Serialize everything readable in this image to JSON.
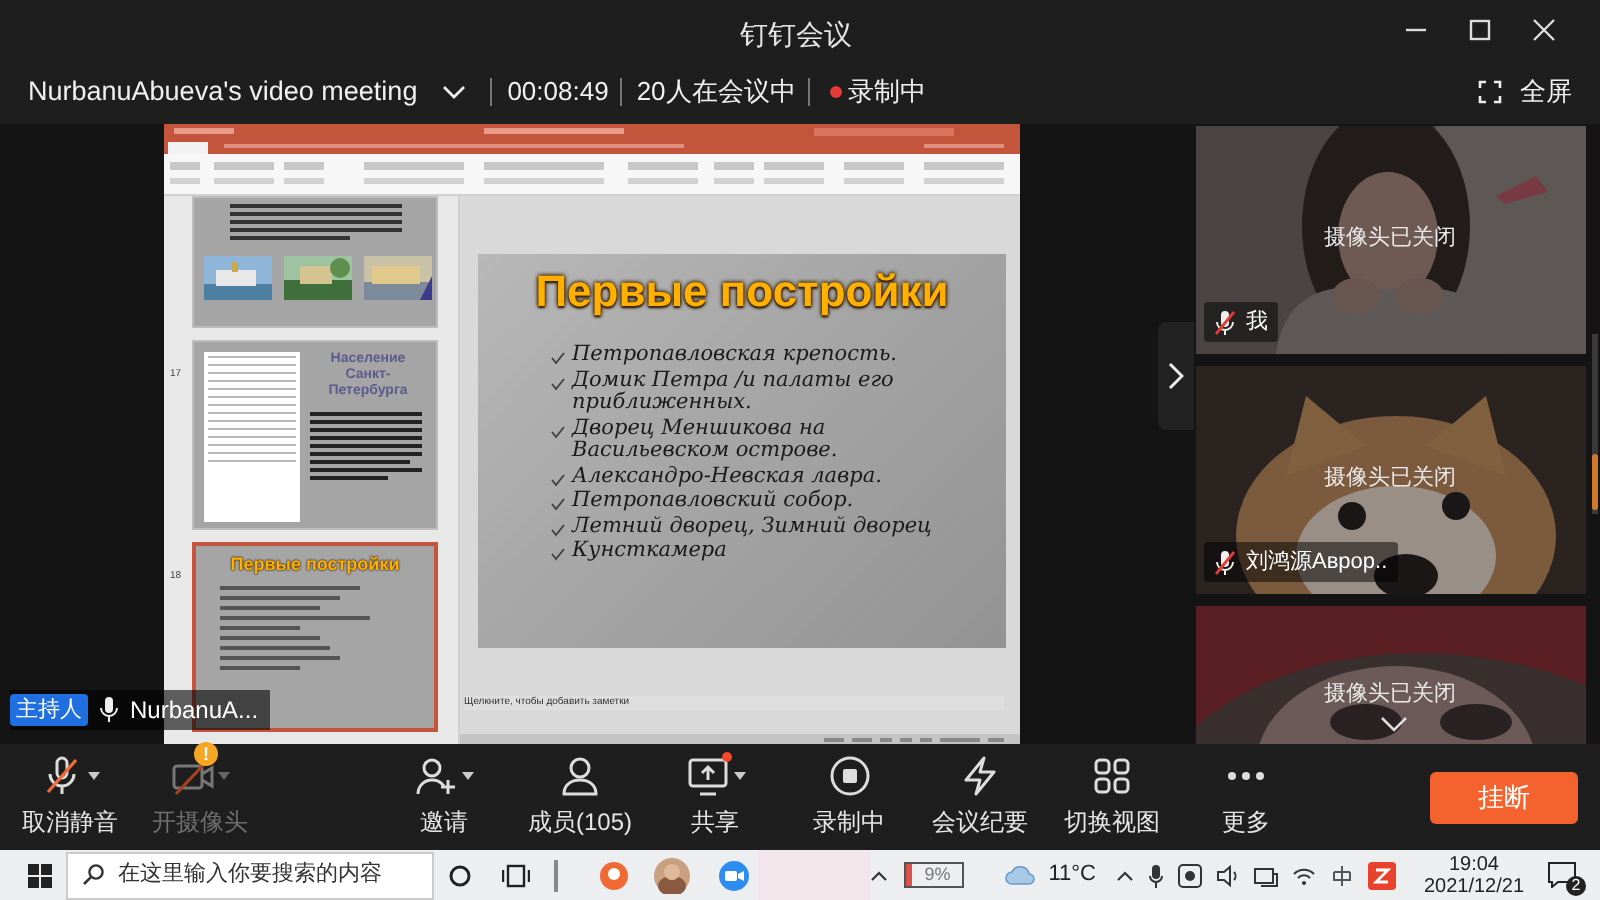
{
  "window": {
    "title": "钉钉会议"
  },
  "meeting": {
    "name": "NurbanuAbueva's video meeting",
    "duration": "00:08:49",
    "participants": "20人在会议中",
    "recording": "录制中",
    "fullscreen": "全屏"
  },
  "shared_screen": {
    "thumbnails": [
      {
        "kind": "photos",
        "selected": false
      },
      {
        "kind": "chart",
        "number": "17",
        "title": "Население Санкт-Петербурга",
        "selected": false
      },
      {
        "kind": "title",
        "number": "18",
        "title": "Первые постройки",
        "selected": true
      }
    ],
    "slide": {
      "title": "Первые постройки",
      "bullets": [
        "Петропавловская крепость.",
        "Домик Петра /и палаты его приближенных.",
        "Дворец Меншикова на Васильевском острове.",
        "Александро-Невская лавра.",
        "Петропавловский собор.",
        "Летний дворец, Зимний дворец",
        "Кунсткамера"
      ]
    },
    "notes_placeholder": "Щелкните, чтобы добавить заметки"
  },
  "host": {
    "role": "主持人",
    "name": "NurbanuA..."
  },
  "video_tiles": [
    {
      "kind": "person",
      "status": "摄像头已关闭",
      "name": "我",
      "muted": true
    },
    {
      "kind": "dog",
      "status": "摄像头已关闭",
      "name": "刘鸿源Аврор..",
      "muted": true
    },
    {
      "kind": "drawing",
      "status": "摄像头已关闭"
    }
  ],
  "toolbar": [
    {
      "kind": "mic",
      "label": "取消静音",
      "has_menu": true,
      "disabled": false
    },
    {
      "kind": "camera",
      "label": "开摄像头",
      "has_menu": true,
      "disabled": true,
      "badge": "!"
    },
    {
      "kind": "invite",
      "label": "邀请",
      "has_menu": true,
      "disabled": false
    },
    {
      "kind": "members",
      "label": "成员(105)",
      "has_menu": false,
      "disabled": false
    },
    {
      "kind": "share",
      "label": "共享",
      "has_menu": true,
      "disabled": false,
      "notified": true
    },
    {
      "kind": "record",
      "label": "录制中",
      "has_menu": false,
      "disabled": false
    },
    {
      "kind": "minutes",
      "label": "会议纪要",
      "has_menu": false,
      "disabled": false
    },
    {
      "kind": "view",
      "label": "切换视图",
      "has_menu": false,
      "disabled": false
    },
    {
      "kind": "more",
      "label": "更多",
      "has_menu": false,
      "disabled": false
    }
  ],
  "hangup": "挂断",
  "taskbar": {
    "search_placeholder": "在这里输入你要搜索的内容",
    "battery": "9%",
    "temperature": "11°C",
    "time": "19:04",
    "date": "2021/12/21",
    "notifications": "2"
  }
}
